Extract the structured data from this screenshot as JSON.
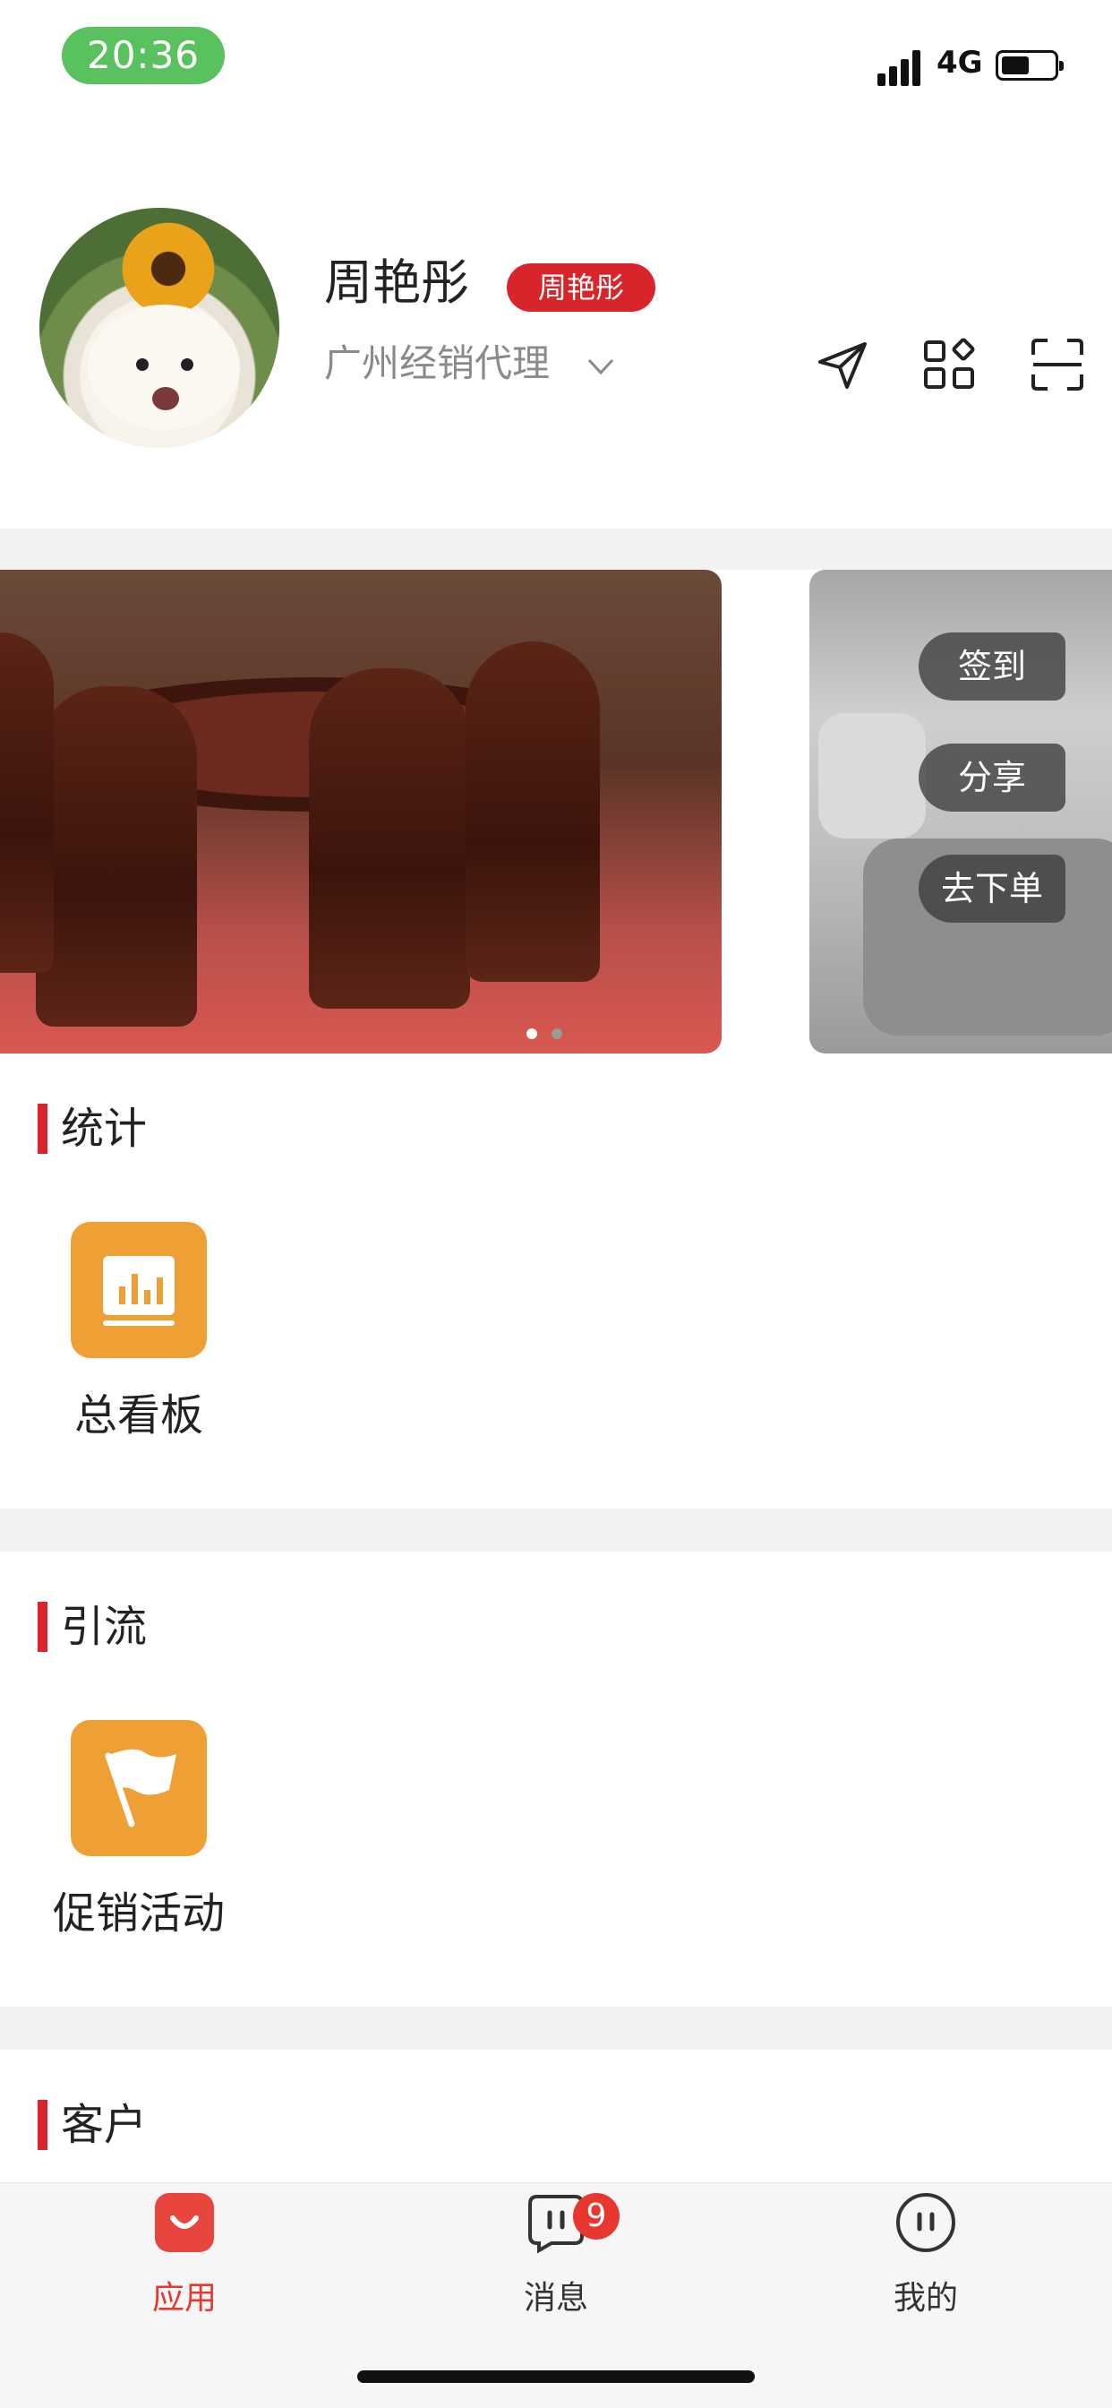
{
  "status_bar": {
    "time": "20:36",
    "network": "4G"
  },
  "profile": {
    "name": "周艳彤",
    "badge": "周艳彤",
    "role": "广州经销代理"
  },
  "header_actions": [
    "send-icon",
    "apps-grid-icon",
    "scan-icon"
  ],
  "banner": {
    "floating_buttons": [
      "签到",
      "分享",
      "去下单"
    ],
    "page_count": 2,
    "active_index": 0
  },
  "sections": [
    {
      "title": "统计",
      "items": [
        {
          "label": "总看板",
          "icon": "chart-icon"
        }
      ]
    },
    {
      "title": "引流",
      "items": [
        {
          "label": "促销活动",
          "icon": "flag-icon"
        }
      ]
    },
    {
      "title": "客户"
    }
  ],
  "tabbar": {
    "tabs": [
      {
        "label": "应用",
        "icon": "shopping-bag-icon",
        "active": true
      },
      {
        "label": "消息",
        "icon": "message-icon",
        "badge": "9"
      },
      {
        "label": "我的",
        "icon": "profile-face-icon"
      }
    ]
  },
  "colors": {
    "accent": "#d8252b",
    "app_icon": "#eea035",
    "time_pill": "#5ac15f"
  }
}
